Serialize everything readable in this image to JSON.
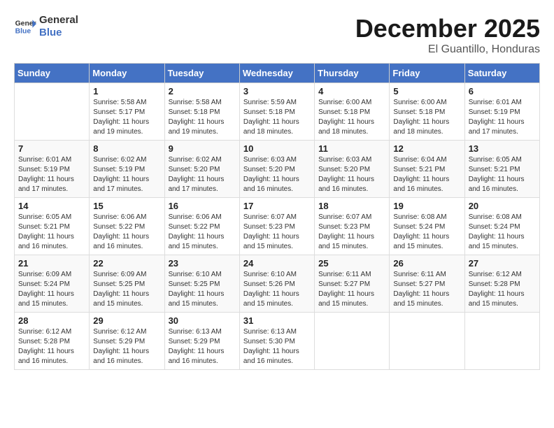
{
  "logo": {
    "line1": "General",
    "line2": "Blue"
  },
  "title": "December 2025",
  "subtitle": "El Guantillo, Honduras",
  "columns": [
    "Sunday",
    "Monday",
    "Tuesday",
    "Wednesday",
    "Thursday",
    "Friday",
    "Saturday"
  ],
  "weeks": [
    [
      {
        "day": "",
        "info": ""
      },
      {
        "day": "1",
        "info": "Sunrise: 5:58 AM\nSunset: 5:17 PM\nDaylight: 11 hours\nand 19 minutes."
      },
      {
        "day": "2",
        "info": "Sunrise: 5:58 AM\nSunset: 5:18 PM\nDaylight: 11 hours\nand 19 minutes."
      },
      {
        "day": "3",
        "info": "Sunrise: 5:59 AM\nSunset: 5:18 PM\nDaylight: 11 hours\nand 18 minutes."
      },
      {
        "day": "4",
        "info": "Sunrise: 6:00 AM\nSunset: 5:18 PM\nDaylight: 11 hours\nand 18 minutes."
      },
      {
        "day": "5",
        "info": "Sunrise: 6:00 AM\nSunset: 5:18 PM\nDaylight: 11 hours\nand 18 minutes."
      },
      {
        "day": "6",
        "info": "Sunrise: 6:01 AM\nSunset: 5:19 PM\nDaylight: 11 hours\nand 17 minutes."
      }
    ],
    [
      {
        "day": "7",
        "info": "Sunrise: 6:01 AM\nSunset: 5:19 PM\nDaylight: 11 hours\nand 17 minutes."
      },
      {
        "day": "8",
        "info": "Sunrise: 6:02 AM\nSunset: 5:19 PM\nDaylight: 11 hours\nand 17 minutes."
      },
      {
        "day": "9",
        "info": "Sunrise: 6:02 AM\nSunset: 5:20 PM\nDaylight: 11 hours\nand 17 minutes."
      },
      {
        "day": "10",
        "info": "Sunrise: 6:03 AM\nSunset: 5:20 PM\nDaylight: 11 hours\nand 16 minutes."
      },
      {
        "day": "11",
        "info": "Sunrise: 6:03 AM\nSunset: 5:20 PM\nDaylight: 11 hours\nand 16 minutes."
      },
      {
        "day": "12",
        "info": "Sunrise: 6:04 AM\nSunset: 5:21 PM\nDaylight: 11 hours\nand 16 minutes."
      },
      {
        "day": "13",
        "info": "Sunrise: 6:05 AM\nSunset: 5:21 PM\nDaylight: 11 hours\nand 16 minutes."
      }
    ],
    [
      {
        "day": "14",
        "info": "Sunrise: 6:05 AM\nSunset: 5:21 PM\nDaylight: 11 hours\nand 16 minutes."
      },
      {
        "day": "15",
        "info": "Sunrise: 6:06 AM\nSunset: 5:22 PM\nDaylight: 11 hours\nand 16 minutes."
      },
      {
        "day": "16",
        "info": "Sunrise: 6:06 AM\nSunset: 5:22 PM\nDaylight: 11 hours\nand 15 minutes."
      },
      {
        "day": "17",
        "info": "Sunrise: 6:07 AM\nSunset: 5:23 PM\nDaylight: 11 hours\nand 15 minutes."
      },
      {
        "day": "18",
        "info": "Sunrise: 6:07 AM\nSunset: 5:23 PM\nDaylight: 11 hours\nand 15 minutes."
      },
      {
        "day": "19",
        "info": "Sunrise: 6:08 AM\nSunset: 5:24 PM\nDaylight: 11 hours\nand 15 minutes."
      },
      {
        "day": "20",
        "info": "Sunrise: 6:08 AM\nSunset: 5:24 PM\nDaylight: 11 hours\nand 15 minutes."
      }
    ],
    [
      {
        "day": "21",
        "info": "Sunrise: 6:09 AM\nSunset: 5:24 PM\nDaylight: 11 hours\nand 15 minutes."
      },
      {
        "day": "22",
        "info": "Sunrise: 6:09 AM\nSunset: 5:25 PM\nDaylight: 11 hours\nand 15 minutes."
      },
      {
        "day": "23",
        "info": "Sunrise: 6:10 AM\nSunset: 5:25 PM\nDaylight: 11 hours\nand 15 minutes."
      },
      {
        "day": "24",
        "info": "Sunrise: 6:10 AM\nSunset: 5:26 PM\nDaylight: 11 hours\nand 15 minutes."
      },
      {
        "day": "25",
        "info": "Sunrise: 6:11 AM\nSunset: 5:27 PM\nDaylight: 11 hours\nand 15 minutes."
      },
      {
        "day": "26",
        "info": "Sunrise: 6:11 AM\nSunset: 5:27 PM\nDaylight: 11 hours\nand 15 minutes."
      },
      {
        "day": "27",
        "info": "Sunrise: 6:12 AM\nSunset: 5:28 PM\nDaylight: 11 hours\nand 15 minutes."
      }
    ],
    [
      {
        "day": "28",
        "info": "Sunrise: 6:12 AM\nSunset: 5:28 PM\nDaylight: 11 hours\nand 16 minutes."
      },
      {
        "day": "29",
        "info": "Sunrise: 6:12 AM\nSunset: 5:29 PM\nDaylight: 11 hours\nand 16 minutes."
      },
      {
        "day": "30",
        "info": "Sunrise: 6:13 AM\nSunset: 5:29 PM\nDaylight: 11 hours\nand 16 minutes."
      },
      {
        "day": "31",
        "info": "Sunrise: 6:13 AM\nSunset: 5:30 PM\nDaylight: 11 hours\nand 16 minutes."
      },
      {
        "day": "",
        "info": ""
      },
      {
        "day": "",
        "info": ""
      },
      {
        "day": "",
        "info": ""
      }
    ]
  ]
}
